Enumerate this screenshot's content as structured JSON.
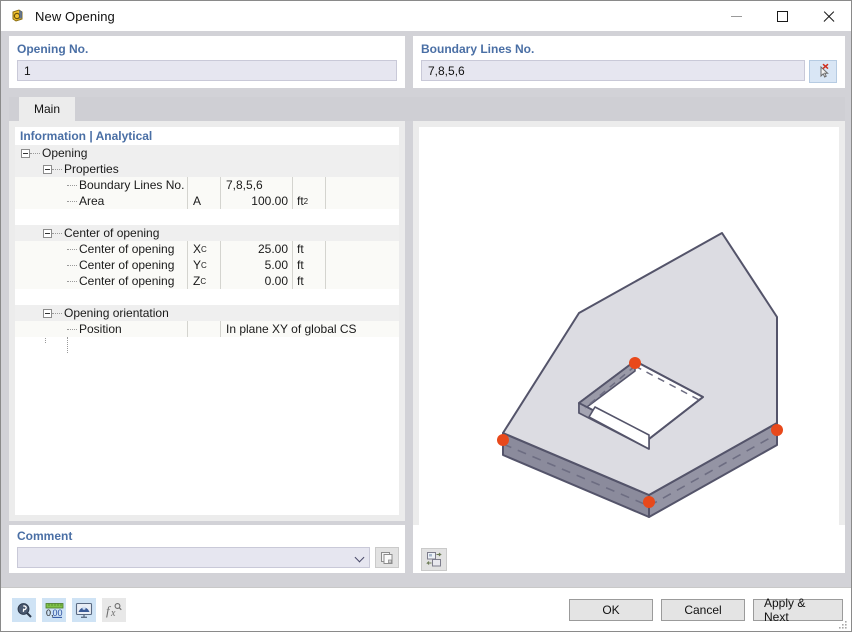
{
  "window": {
    "title": "New Opening",
    "icon": "opening-app-icon",
    "controls": {
      "minimize": "minimize-icon",
      "maximize": "maximize-icon",
      "close": "close-icon"
    }
  },
  "opening_no": {
    "label": "Opening No.",
    "value": "1"
  },
  "boundary_lines": {
    "label": "Boundary Lines No.",
    "value": "7,8,5,6",
    "pick_icon": "select-objects-cursor-icon"
  },
  "tabs": [
    {
      "label": "Main",
      "active": true
    }
  ],
  "tree": {
    "header": "Information | Analytical",
    "rows": [
      {
        "kind": "group",
        "level": 0,
        "label": "Opening",
        "expander": true
      },
      {
        "kind": "group",
        "level": 1,
        "label": "Properties",
        "expander": true
      },
      {
        "kind": "item",
        "level": 2,
        "label": "Boundary Lines No.",
        "symbol": "",
        "value": "7,8,5,6",
        "unit": "",
        "value_align": "left"
      },
      {
        "kind": "item",
        "level": 2,
        "label": "Area",
        "symbol": "A",
        "value": "100.00",
        "unit": "ft²",
        "unit_sup": "2",
        "unit_base": "ft"
      },
      {
        "kind": "blank"
      },
      {
        "kind": "group",
        "level": 1,
        "label": "Center of opening",
        "expander": true
      },
      {
        "kind": "item",
        "level": 2,
        "label": "Center of opening",
        "symbol": "X",
        "symbol_sub": "C",
        "value": "25.00",
        "unit": "ft"
      },
      {
        "kind": "item",
        "level": 2,
        "label": "Center of opening",
        "symbol": "Y",
        "symbol_sub": "C",
        "value": "5.00",
        "unit": "ft"
      },
      {
        "kind": "item",
        "level": 2,
        "label": "Center of opening",
        "symbol": "Z",
        "symbol_sub": "C",
        "value": "0.00",
        "unit": "ft"
      },
      {
        "kind": "blank"
      },
      {
        "kind": "group",
        "level": 1,
        "label": "Opening orientation",
        "expander": true
      },
      {
        "kind": "item_wide",
        "level": 2,
        "label": "Position",
        "symbol": "",
        "value": "In plane XY of global CS"
      }
    ]
  },
  "viewport": {
    "name": "3d-model-preview",
    "surface_top_color": "#dcdce2",
    "surface_side_color": "#8b8b9c",
    "edge_color": "#54546a",
    "node_color": "#e8491b"
  },
  "comment": {
    "label": "Comment",
    "value": "",
    "placeholder": "",
    "chevron_icon": "chevron-down-icon",
    "copy_icon": "copy-pages-icon"
  },
  "transfer": {
    "icon": "transfer-import-export-icon"
  },
  "toolbar": {
    "icons": [
      {
        "name": "info-magnifier-icon",
        "glyph": "⌕",
        "state": "on"
      },
      {
        "name": "decimal-places-icon",
        "glyph": "0,00",
        "state": "on"
      },
      {
        "name": "display-properties-icon",
        "glyph": "◰",
        "state": "on"
      },
      {
        "name": "formula-fx-icon",
        "glyph": "ƒx",
        "state": "off"
      }
    ]
  },
  "actions": {
    "ok": "OK",
    "cancel": "Cancel",
    "apply_next": "Apply & Next"
  },
  "colors": {
    "accent_label": "#4a6fa5",
    "field_bg": "#e6e6f0",
    "dialog_bg": "#d2d2d7",
    "panel_bg": "#ececec",
    "node_marker": "#e8491b"
  }
}
